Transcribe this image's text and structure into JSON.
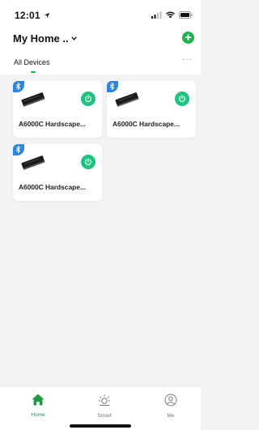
{
  "status_bar": {
    "time": "12:01"
  },
  "header": {
    "home_title": "My Home ..",
    "add_label": "+"
  },
  "tabs": {
    "active_label": "All Devices",
    "more_label": "···"
  },
  "devices": [
    {
      "name": "A6000C Hardscape...",
      "connection": "bluetooth-icon"
    },
    {
      "name": "A6000C Hardscape...",
      "connection": "bluetooth-icon"
    },
    {
      "name": "A6000C Hardscape...",
      "connection": "bluetooth-icon"
    }
  ],
  "bottom_nav": {
    "items": [
      {
        "label": "Home",
        "icon": "home-icon",
        "active": true
      },
      {
        "label": "Smart",
        "icon": "sun-icon",
        "active": false
      },
      {
        "label": "Me",
        "icon": "user-icon",
        "active": false
      }
    ]
  },
  "colors": {
    "accent_green": "#1db34a",
    "power_green": "#20c281",
    "bluetooth_blue": "#2b86e6",
    "background": "#f3f3f3"
  }
}
